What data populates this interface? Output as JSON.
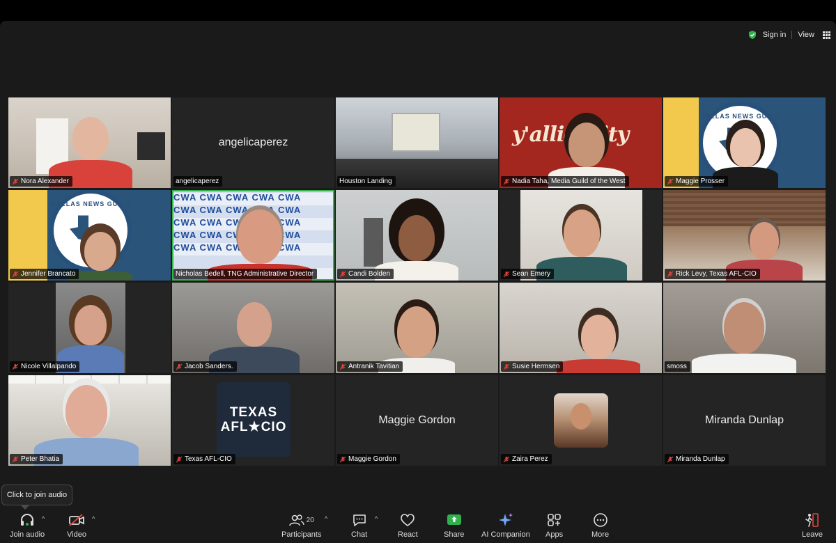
{
  "topbar": {
    "sign_in": "Sign in",
    "view": "View"
  },
  "tiles": [
    {
      "name": "Nora Alexander",
      "muted": true
    },
    {
      "name": "angelicaperez",
      "display": "angelicaperez",
      "muted": false
    },
    {
      "name": "Houston Landing",
      "muted": false
    },
    {
      "name": "Nadia Taha, Media Guild of the West",
      "muted": true,
      "bg_text": "y'allidarity"
    },
    {
      "name": "Maggie Prosser",
      "muted": true
    },
    {
      "name": "Jennifer Brancato",
      "muted": true
    },
    {
      "name": "Nicholas Bedell, TNG Administrative Director",
      "muted": false,
      "active": true,
      "bg_text": "CWA"
    },
    {
      "name": "Candi Bolden",
      "muted": true
    },
    {
      "name": "Sean Emery",
      "muted": true
    },
    {
      "name": "Rick Levy,  Texas AFL-CIO",
      "muted": true
    },
    {
      "name": "Nicole Villalpando",
      "muted": true
    },
    {
      "name": "Jacob Sanders.",
      "muted": true
    },
    {
      "name": "Antranik Tavitian",
      "muted": true
    },
    {
      "name": "Susie Hermsen",
      "muted": true
    },
    {
      "name": "smoss",
      "muted": false
    },
    {
      "name": "Peter Bhatia",
      "muted": true
    },
    {
      "name": "Texas AFL-CIO",
      "muted": true,
      "logo_line1": "TEXAS",
      "logo_line2": "AFL★CIO"
    },
    {
      "name": "Maggie Gordon",
      "display": "Maggie Gordon",
      "muted": true
    },
    {
      "name": "Zaira Perez",
      "muted": true
    },
    {
      "name": "Miranda Dunlap",
      "display": "Miranda Dunlap",
      "muted": true
    }
  ],
  "logos": {
    "dng_text": "DALLAS NEWS GUILD"
  },
  "tooltip": "Click to join audio",
  "toolbar": {
    "join_audio": "Join audio",
    "video": "Video",
    "participants": "Participants",
    "participants_count": "20",
    "chat": "Chat",
    "react": "React",
    "share": "Share",
    "ai_companion": "AI Companion",
    "apps": "Apps",
    "more": "More",
    "leave": "Leave"
  },
  "colors": {
    "active_speaker": "#35b34a",
    "share_green": "#2fb14d",
    "leave_red": "#e0453a",
    "muted_red": "#e0453a"
  }
}
